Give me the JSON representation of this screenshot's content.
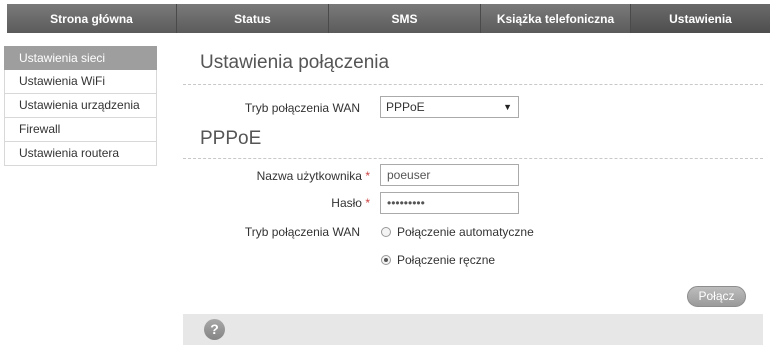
{
  "topnav": {
    "tabs": [
      {
        "label": "Strona główna"
      },
      {
        "label": "Status"
      },
      {
        "label": "SMS"
      },
      {
        "label": "Książka telefoniczna"
      },
      {
        "label": "Ustawienia",
        "active": true
      }
    ]
  },
  "sidebar": {
    "items": [
      {
        "label": "Ustawienia sieci",
        "active": true
      },
      {
        "label": "Ustawienia WiFi"
      },
      {
        "label": "Ustawienia urządzenia"
      },
      {
        "label": "Firewall"
      },
      {
        "label": "Ustawienia routera"
      }
    ]
  },
  "main": {
    "title": "Ustawienia połączenia",
    "wan_mode_label": "Tryb połączenia WAN",
    "wan_mode_value": "PPPoE",
    "pppoe_title": "PPPoE",
    "username_label": "Nazwa użytkownika",
    "username_value": "poeuser",
    "password_label": "Hasło",
    "password_value": "•••••••••",
    "required_mark": "*",
    "conn_mode_label": "Tryb połączenia WAN",
    "radio_auto_label": "Połączenie automatyczne",
    "radio_manual_label": "Połączenie ręczne",
    "radio_selected": "manual",
    "connect_button": "Połącz"
  },
  "footer": {
    "help_glyph": "?"
  }
}
